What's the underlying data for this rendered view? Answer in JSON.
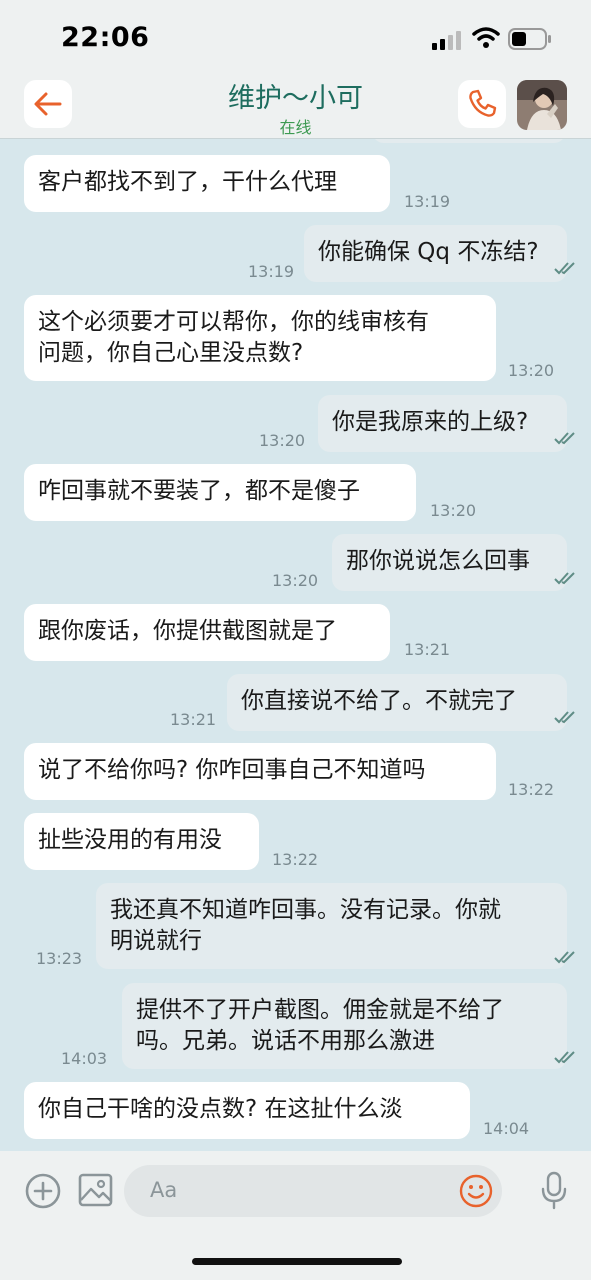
{
  "status_bar": {
    "time": "22:06"
  },
  "header": {
    "title": "维护～小可",
    "status": "在线"
  },
  "messages": [
    {
      "dir": "in",
      "text": "客户都找不到了，干什么代理",
      "time": "13:19"
    },
    {
      "dir": "out",
      "text": "你能确保 Qq 不冻结?",
      "time": "13:19",
      "read": true
    },
    {
      "dir": "in",
      "lines": [
        "这个必须要才可以帮你，你的线审核有",
        "问题，你自己心里没点数?"
      ],
      "time": "13:20"
    },
    {
      "dir": "out",
      "text": "你是我原来的上级?",
      "time": "13:20",
      "read": true
    },
    {
      "dir": "in",
      "text": "咋回事就不要装了，都不是傻子",
      "time": "13:20"
    },
    {
      "dir": "out",
      "text": "那你说说怎么回事",
      "time": "13:20",
      "read": true
    },
    {
      "dir": "in",
      "text": "跟你废话，你提供截图就是了",
      "time": "13:21"
    },
    {
      "dir": "out",
      "text": "你直接说不给了。不就完了",
      "time": "13:21",
      "read": true
    },
    {
      "dir": "in",
      "text": "说了不给你吗? 你咋回事自己不知道吗",
      "time": "13:22"
    },
    {
      "dir": "in",
      "text": "扯些没用的有用没",
      "time": "13:22"
    },
    {
      "dir": "out",
      "lines": [
        "我还真不知道咋回事。没有记录。你就",
        "明说就行"
      ],
      "time": "13:23",
      "read": true
    },
    {
      "dir": "out",
      "lines": [
        "提供不了开户截图。佣金就是不给了",
        "吗。兄弟。说话不用那么激进"
      ],
      "time": "14:03",
      "read": true
    },
    {
      "dir": "in",
      "text": "你自己干啥的没点数? 在这扯什么淡",
      "time": "14:04"
    }
  ],
  "input": {
    "placeholder": "Aa"
  },
  "icons": {
    "back": "arrow-left-icon",
    "call": "phone-icon",
    "add": "plus-circle-icon",
    "image": "image-icon",
    "emoji": "smile-icon",
    "mic": "microphone-icon"
  },
  "colors": {
    "accent": "#e8622c",
    "title": "#1e6d5f",
    "online": "#3d9a52",
    "read_check": "#5f8d86"
  }
}
